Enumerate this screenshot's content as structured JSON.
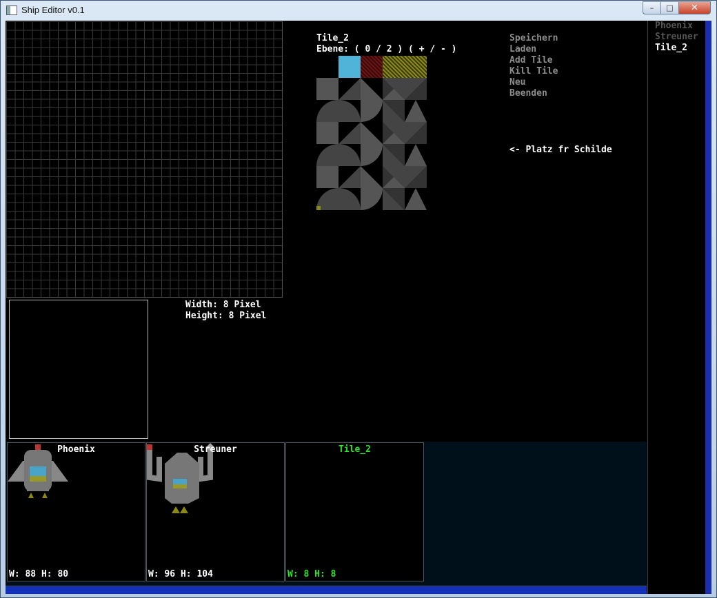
{
  "window": {
    "title": "Ship Editor v0.1",
    "minimize": "–",
    "maximize": "□",
    "close": "✕"
  },
  "editor": {
    "tile_name": "Tile_2",
    "layer_text": "Ebene: ( 0 / 2 ) ( + / - )",
    "width_text": "Width: 8 Pixel",
    "height_text": "Height: 8 Pixel",
    "shield_note": "<- Platz fr Schilde"
  },
  "colors": {
    "swatch1": "#4fb4d8",
    "swatch2": "#6b1414",
    "swatch3": "#8a8a14",
    "selected": "#27e627"
  },
  "menu": [
    {
      "label": "Speichern"
    },
    {
      "label": "Laden"
    },
    {
      "label": "Add Tile"
    },
    {
      "label": "Kill Tile"
    },
    {
      "label": "Neu"
    },
    {
      "label": "Beenden"
    }
  ],
  "ship_list": [
    {
      "name": "Phoenix",
      "active": false
    },
    {
      "name": "Streuner",
      "active": false
    },
    {
      "name": "Tile_2",
      "active": true
    }
  ],
  "cards": [
    {
      "name": "Phoenix",
      "wh": "W: 88 H: 80"
    },
    {
      "name": "Streuner",
      "wh": "W: 96 H: 104"
    },
    {
      "name": "Tile_2",
      "wh": "W: 8 H: 8"
    }
  ]
}
